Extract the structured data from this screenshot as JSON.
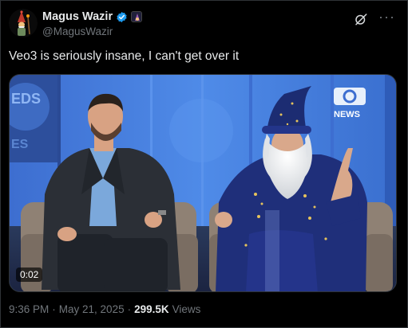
{
  "author": {
    "display_name": "Magus Wazir",
    "handle": "@MagusWazir",
    "avatar_icon": "wizard-avatar",
    "verified_icon": "verified-badge-icon",
    "affiliate_icon": "affiliate-badge-icon"
  },
  "tweet": {
    "text": "Veo3 is seriously insane, I can't get over it"
  },
  "media": {
    "duration": "0:02",
    "logo_text": "NEWS",
    "bg_text_1": "EDS",
    "bg_text_2": "ES"
  },
  "meta": {
    "time": "9:36 PM",
    "sep1": "·",
    "date": "May 21, 2025",
    "sep2": "·",
    "views_count": "299.5K",
    "views_label": "Views"
  },
  "colors": {
    "verified": "#1d9bf0",
    "text": "#e7e9ea",
    "muted": "#71767b"
  }
}
